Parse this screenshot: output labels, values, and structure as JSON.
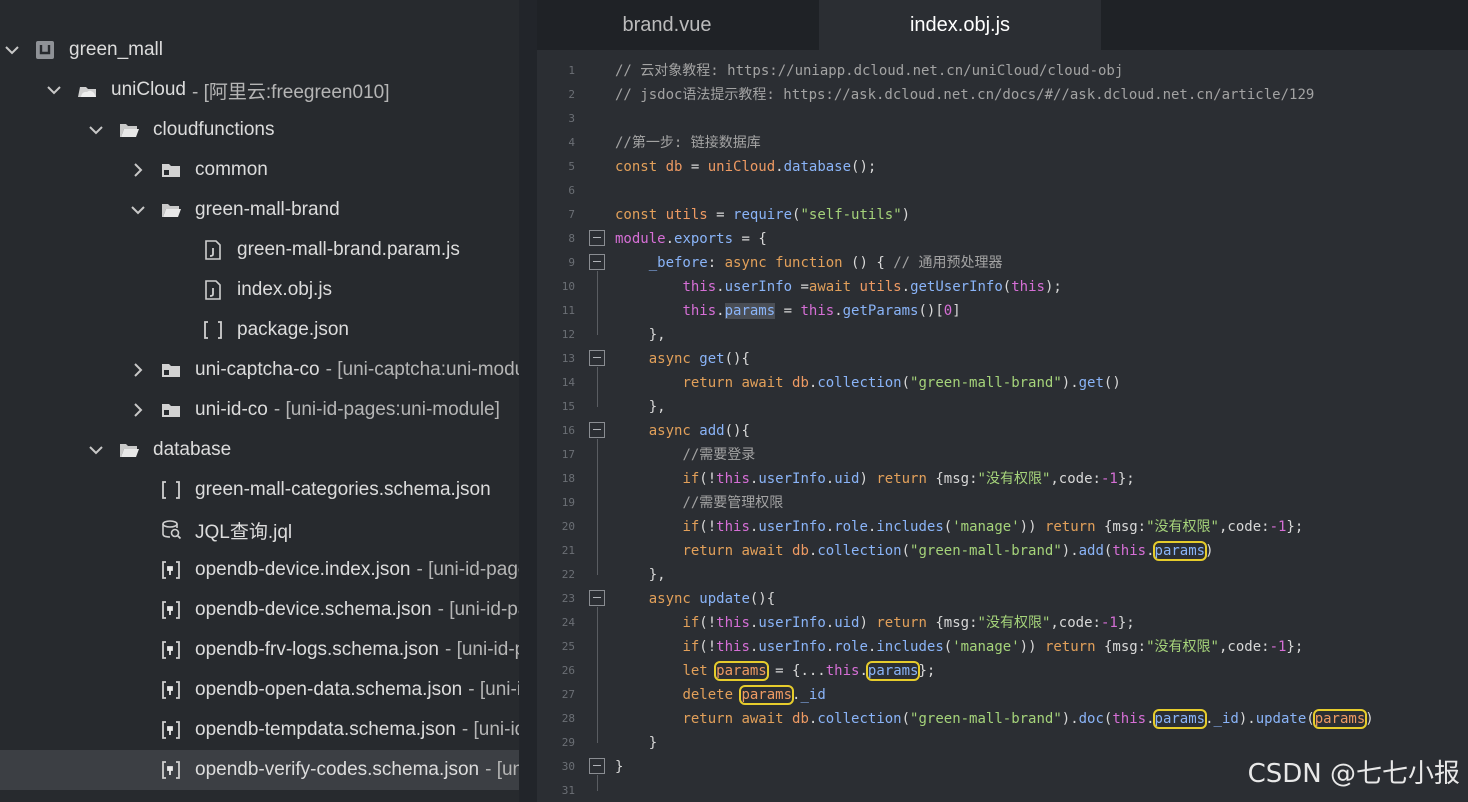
{
  "tabs": [
    {
      "label": "brand.vue",
      "active": false
    },
    {
      "label": "index.obj.js",
      "active": true
    }
  ],
  "tree": [
    {
      "label": "green_mall",
      "suffix": "",
      "depth": 0,
      "chevron": "down",
      "icon": "project-icon"
    },
    {
      "label": "uniCloud",
      "suffix": "- [阿里云:freegreen010]",
      "depth": 1,
      "chevron": "down",
      "icon": "cloud-icon"
    },
    {
      "label": "cloudfunctions",
      "suffix": "",
      "depth": 2,
      "chevron": "down",
      "icon": "folder-open-icon"
    },
    {
      "label": "common",
      "suffix": "",
      "depth": 3,
      "chevron": "right",
      "icon": "folder-icon"
    },
    {
      "label": "green-mall-brand",
      "suffix": "",
      "depth": 3,
      "chevron": "down",
      "icon": "folder-open-icon"
    },
    {
      "label": "green-mall-brand.param.js",
      "suffix": "",
      "depth": 4,
      "chevron": "",
      "icon": "file-js-icon"
    },
    {
      "label": "index.obj.js",
      "suffix": "",
      "depth": 4,
      "chevron": "",
      "icon": "file-js-icon"
    },
    {
      "label": "package.json",
      "suffix": "",
      "depth": 4,
      "chevron": "",
      "icon": "json-bracket-icon"
    },
    {
      "label": "uni-captcha-co",
      "suffix": "- [uni-captcha:uni-module]",
      "depth": 3,
      "chevron": "right",
      "icon": "folder-icon"
    },
    {
      "label": "uni-id-co",
      "suffix": "- [uni-id-pages:uni-module]",
      "depth": 3,
      "chevron": "right",
      "icon": "folder-icon"
    },
    {
      "label": "database",
      "suffix": "",
      "depth": 2,
      "chevron": "down",
      "icon": "folder-open-icon"
    },
    {
      "label": "green-mall-categories.schema.json",
      "suffix": "",
      "depth": 3,
      "chevron": "",
      "icon": "json-bracket-icon"
    },
    {
      "label": "JQL查询.jql",
      "suffix": "",
      "depth": 3,
      "chevron": "",
      "icon": "jql-icon"
    },
    {
      "label": "opendb-device.index.json",
      "suffix": "- [uni-id-pages]",
      "depth": 3,
      "chevron": "",
      "icon": "json-module-icon"
    },
    {
      "label": "opendb-device.schema.json",
      "suffix": "- [uni-id-pages]",
      "depth": 3,
      "chevron": "",
      "icon": "json-module-icon"
    },
    {
      "label": "opendb-frv-logs.schema.json",
      "suffix": "- [uni-id-pages]",
      "depth": 3,
      "chevron": "",
      "icon": "json-module-icon"
    },
    {
      "label": "opendb-open-data.schema.json",
      "suffix": "- [uni-id-pages]",
      "depth": 3,
      "chevron": "",
      "icon": "json-module-icon"
    },
    {
      "label": "opendb-tempdata.schema.json",
      "suffix": "- [uni-id-pages]",
      "depth": 3,
      "chevron": "",
      "icon": "json-module-icon"
    },
    {
      "label": "opendb-verify-codes.schema.json",
      "suffix": "- [uni-id-pages]",
      "depth": 3,
      "chevron": "",
      "icon": "json-module-icon",
      "selected": true
    }
  ],
  "code_lines": [
    [
      [
        "c",
        "// 云对象教程: https://uniapp.dcloud.net.cn/uniCloud/cloud-obj"
      ]
    ],
    [
      [
        "c",
        "// jsdoc语法提示教程: https://ask.dcloud.net.cn/docs/#//ask.dcloud.net.cn/article/129"
      ]
    ],
    [],
    [
      [
        "c",
        "//第一步: 链接数据库"
      ]
    ],
    [
      [
        "k",
        "const "
      ],
      [
        "v",
        "db"
      ],
      [
        "p",
        " = "
      ],
      [
        "v",
        "uniCloud"
      ],
      [
        "p",
        "."
      ],
      [
        "f",
        "database"
      ],
      [
        "p",
        "();"
      ]
    ],
    [],
    [
      [
        "k",
        "const "
      ],
      [
        "v",
        "utils"
      ],
      [
        "p",
        " = "
      ],
      [
        "f",
        "require"
      ],
      [
        "p",
        "("
      ],
      [
        "s",
        "\"self-utils\""
      ],
      [
        "p",
        ")"
      ]
    ],
    [
      [
        "m",
        "module"
      ],
      [
        "p",
        "."
      ],
      [
        "f",
        "exports"
      ],
      [
        "p",
        " = {"
      ]
    ],
    [
      [
        "p",
        "    "
      ],
      [
        "f",
        "_before"
      ],
      [
        "p",
        ": "
      ],
      [
        "k",
        "async function"
      ],
      [
        "p",
        " () { "
      ],
      [
        "c",
        "// 通用预处理器"
      ]
    ],
    [
      [
        "p",
        "        "
      ],
      [
        "m",
        "this"
      ],
      [
        "p",
        "."
      ],
      [
        "f",
        "userInfo"
      ],
      [
        "p",
        " ="
      ],
      [
        "k",
        "await "
      ],
      [
        "v",
        "utils"
      ],
      [
        "p",
        "."
      ],
      [
        "f",
        "getUserInfo"
      ],
      [
        "p",
        "("
      ],
      [
        "m",
        "this"
      ],
      [
        "p",
        ");"
      ]
    ],
    [
      [
        "p",
        "        "
      ],
      [
        "m",
        "this"
      ],
      [
        "p",
        "."
      ],
      [
        "f hl",
        "params"
      ],
      [
        "p",
        " = "
      ],
      [
        "m",
        "this"
      ],
      [
        "p",
        "."
      ],
      [
        "f",
        "getParams"
      ],
      [
        "p",
        "()["
      ],
      [
        "m",
        "0"
      ],
      [
        "p",
        "]"
      ]
    ],
    [
      [
        "p",
        "    },"
      ]
    ],
    [
      [
        "p",
        "    "
      ],
      [
        "k",
        "async "
      ],
      [
        "f",
        "get"
      ],
      [
        "p",
        "(){"
      ]
    ],
    [
      [
        "p",
        "        "
      ],
      [
        "k",
        "return await "
      ],
      [
        "v",
        "db"
      ],
      [
        "p",
        "."
      ],
      [
        "f",
        "collection"
      ],
      [
        "p",
        "("
      ],
      [
        "s",
        "\"green-mall-brand\""
      ],
      [
        "p",
        ")."
      ],
      [
        "f",
        "get"
      ],
      [
        "p",
        "()"
      ]
    ],
    [
      [
        "p",
        "    },"
      ]
    ],
    [
      [
        "p",
        "    "
      ],
      [
        "k",
        "async "
      ],
      [
        "f",
        "add"
      ],
      [
        "p",
        "(){"
      ]
    ],
    [
      [
        "p",
        "        "
      ],
      [
        "c",
        "//需要登录"
      ]
    ],
    [
      [
        "p",
        "        "
      ],
      [
        "k",
        "if"
      ],
      [
        "p",
        "(!"
      ],
      [
        "m",
        "this"
      ],
      [
        "p",
        "."
      ],
      [
        "f",
        "userInfo"
      ],
      [
        "p",
        "."
      ],
      [
        "f",
        "uid"
      ],
      [
        "p",
        ") "
      ],
      [
        "k",
        "return "
      ],
      [
        "p",
        "{msg:"
      ],
      [
        "s",
        "\"没有权限\""
      ],
      [
        "p",
        ",code:"
      ],
      [
        "m",
        "-1"
      ],
      [
        "p",
        "};"
      ]
    ],
    [
      [
        "p",
        "        "
      ],
      [
        "c",
        "//需要管理权限"
      ]
    ],
    [
      [
        "p",
        "        "
      ],
      [
        "k",
        "if"
      ],
      [
        "p",
        "(!"
      ],
      [
        "m",
        "this"
      ],
      [
        "p",
        "."
      ],
      [
        "f",
        "userInfo"
      ],
      [
        "p",
        "."
      ],
      [
        "f",
        "role"
      ],
      [
        "p",
        "."
      ],
      [
        "f",
        "includes"
      ],
      [
        "p",
        "("
      ],
      [
        "s",
        "'manage'"
      ],
      [
        "p",
        ")) "
      ],
      [
        "k",
        "return "
      ],
      [
        "p",
        "{msg:"
      ],
      [
        "s",
        "\"没有权限\""
      ],
      [
        "p",
        ",code:"
      ],
      [
        "m",
        "-1"
      ],
      [
        "p",
        "};"
      ]
    ],
    [
      [
        "p",
        "        "
      ],
      [
        "k",
        "return await "
      ],
      [
        "v",
        "db"
      ],
      [
        "p",
        "."
      ],
      [
        "f",
        "collection"
      ],
      [
        "p",
        "("
      ],
      [
        "s",
        "\"green-mall-brand\""
      ],
      [
        "p",
        ")."
      ],
      [
        "f",
        "add"
      ],
      [
        "p",
        "("
      ],
      [
        "m",
        "this"
      ],
      [
        "p",
        "."
      ],
      [
        "f box",
        "params"
      ],
      [
        "p",
        ")"
      ]
    ],
    [
      [
        "p",
        "    },"
      ]
    ],
    [
      [
        "p",
        "    "
      ],
      [
        "k",
        "async "
      ],
      [
        "f",
        "update"
      ],
      [
        "p",
        "(){"
      ]
    ],
    [
      [
        "p",
        "        "
      ],
      [
        "k",
        "if"
      ],
      [
        "p",
        "(!"
      ],
      [
        "m",
        "this"
      ],
      [
        "p",
        "."
      ],
      [
        "f",
        "userInfo"
      ],
      [
        "p",
        "."
      ],
      [
        "f",
        "uid"
      ],
      [
        "p",
        ") "
      ],
      [
        "k",
        "return "
      ],
      [
        "p",
        "{msg:"
      ],
      [
        "s",
        "\"没有权限\""
      ],
      [
        "p",
        ",code:"
      ],
      [
        "m",
        "-1"
      ],
      [
        "p",
        "};"
      ]
    ],
    [
      [
        "p",
        "        "
      ],
      [
        "k",
        "if"
      ],
      [
        "p",
        "(!"
      ],
      [
        "m",
        "this"
      ],
      [
        "p",
        "."
      ],
      [
        "f",
        "userInfo"
      ],
      [
        "p",
        "."
      ],
      [
        "f",
        "role"
      ],
      [
        "p",
        "."
      ],
      [
        "f",
        "includes"
      ],
      [
        "p",
        "("
      ],
      [
        "s",
        "'manage'"
      ],
      [
        "p",
        ")) "
      ],
      [
        "k",
        "return "
      ],
      [
        "p",
        "{msg:"
      ],
      [
        "s",
        "\"没有权限\""
      ],
      [
        "p",
        ",code:"
      ],
      [
        "m",
        "-1"
      ],
      [
        "p",
        "};"
      ]
    ],
    [
      [
        "p",
        "        "
      ],
      [
        "k",
        "let "
      ],
      [
        "v box",
        "params"
      ],
      [
        "p",
        " = {..."
      ],
      [
        "m",
        "this"
      ],
      [
        "p",
        "."
      ],
      [
        "f box",
        "params"
      ],
      [
        "p",
        "};"
      ]
    ],
    [
      [
        "p",
        "        "
      ],
      [
        "k",
        "delete "
      ],
      [
        "v box",
        "params"
      ],
      [
        "p",
        "."
      ],
      [
        "f",
        "_id"
      ]
    ],
    [
      [
        "p",
        "        "
      ],
      [
        "k",
        "return await "
      ],
      [
        "v",
        "db"
      ],
      [
        "p",
        "."
      ],
      [
        "f",
        "collection"
      ],
      [
        "p",
        "("
      ],
      [
        "s",
        "\"green-mall-brand\""
      ],
      [
        "p",
        ")."
      ],
      [
        "f",
        "doc"
      ],
      [
        "p",
        "("
      ],
      [
        "m",
        "this"
      ],
      [
        "p",
        "."
      ],
      [
        "f box",
        "params"
      ],
      [
        "p",
        "."
      ],
      [
        "f",
        "_id"
      ],
      [
        "p",
        ")."
      ],
      [
        "f",
        "update"
      ],
      [
        "p",
        "("
      ],
      [
        "v box",
        "params"
      ],
      [
        "p",
        ")"
      ]
    ],
    [
      [
        "p",
        "    }"
      ]
    ],
    [
      [
        "p",
        "}"
      ]
    ],
    []
  ],
  "fold_lines": [
    8,
    9,
    13,
    16,
    23,
    30
  ],
  "watermark": "CSDN @七七小报"
}
